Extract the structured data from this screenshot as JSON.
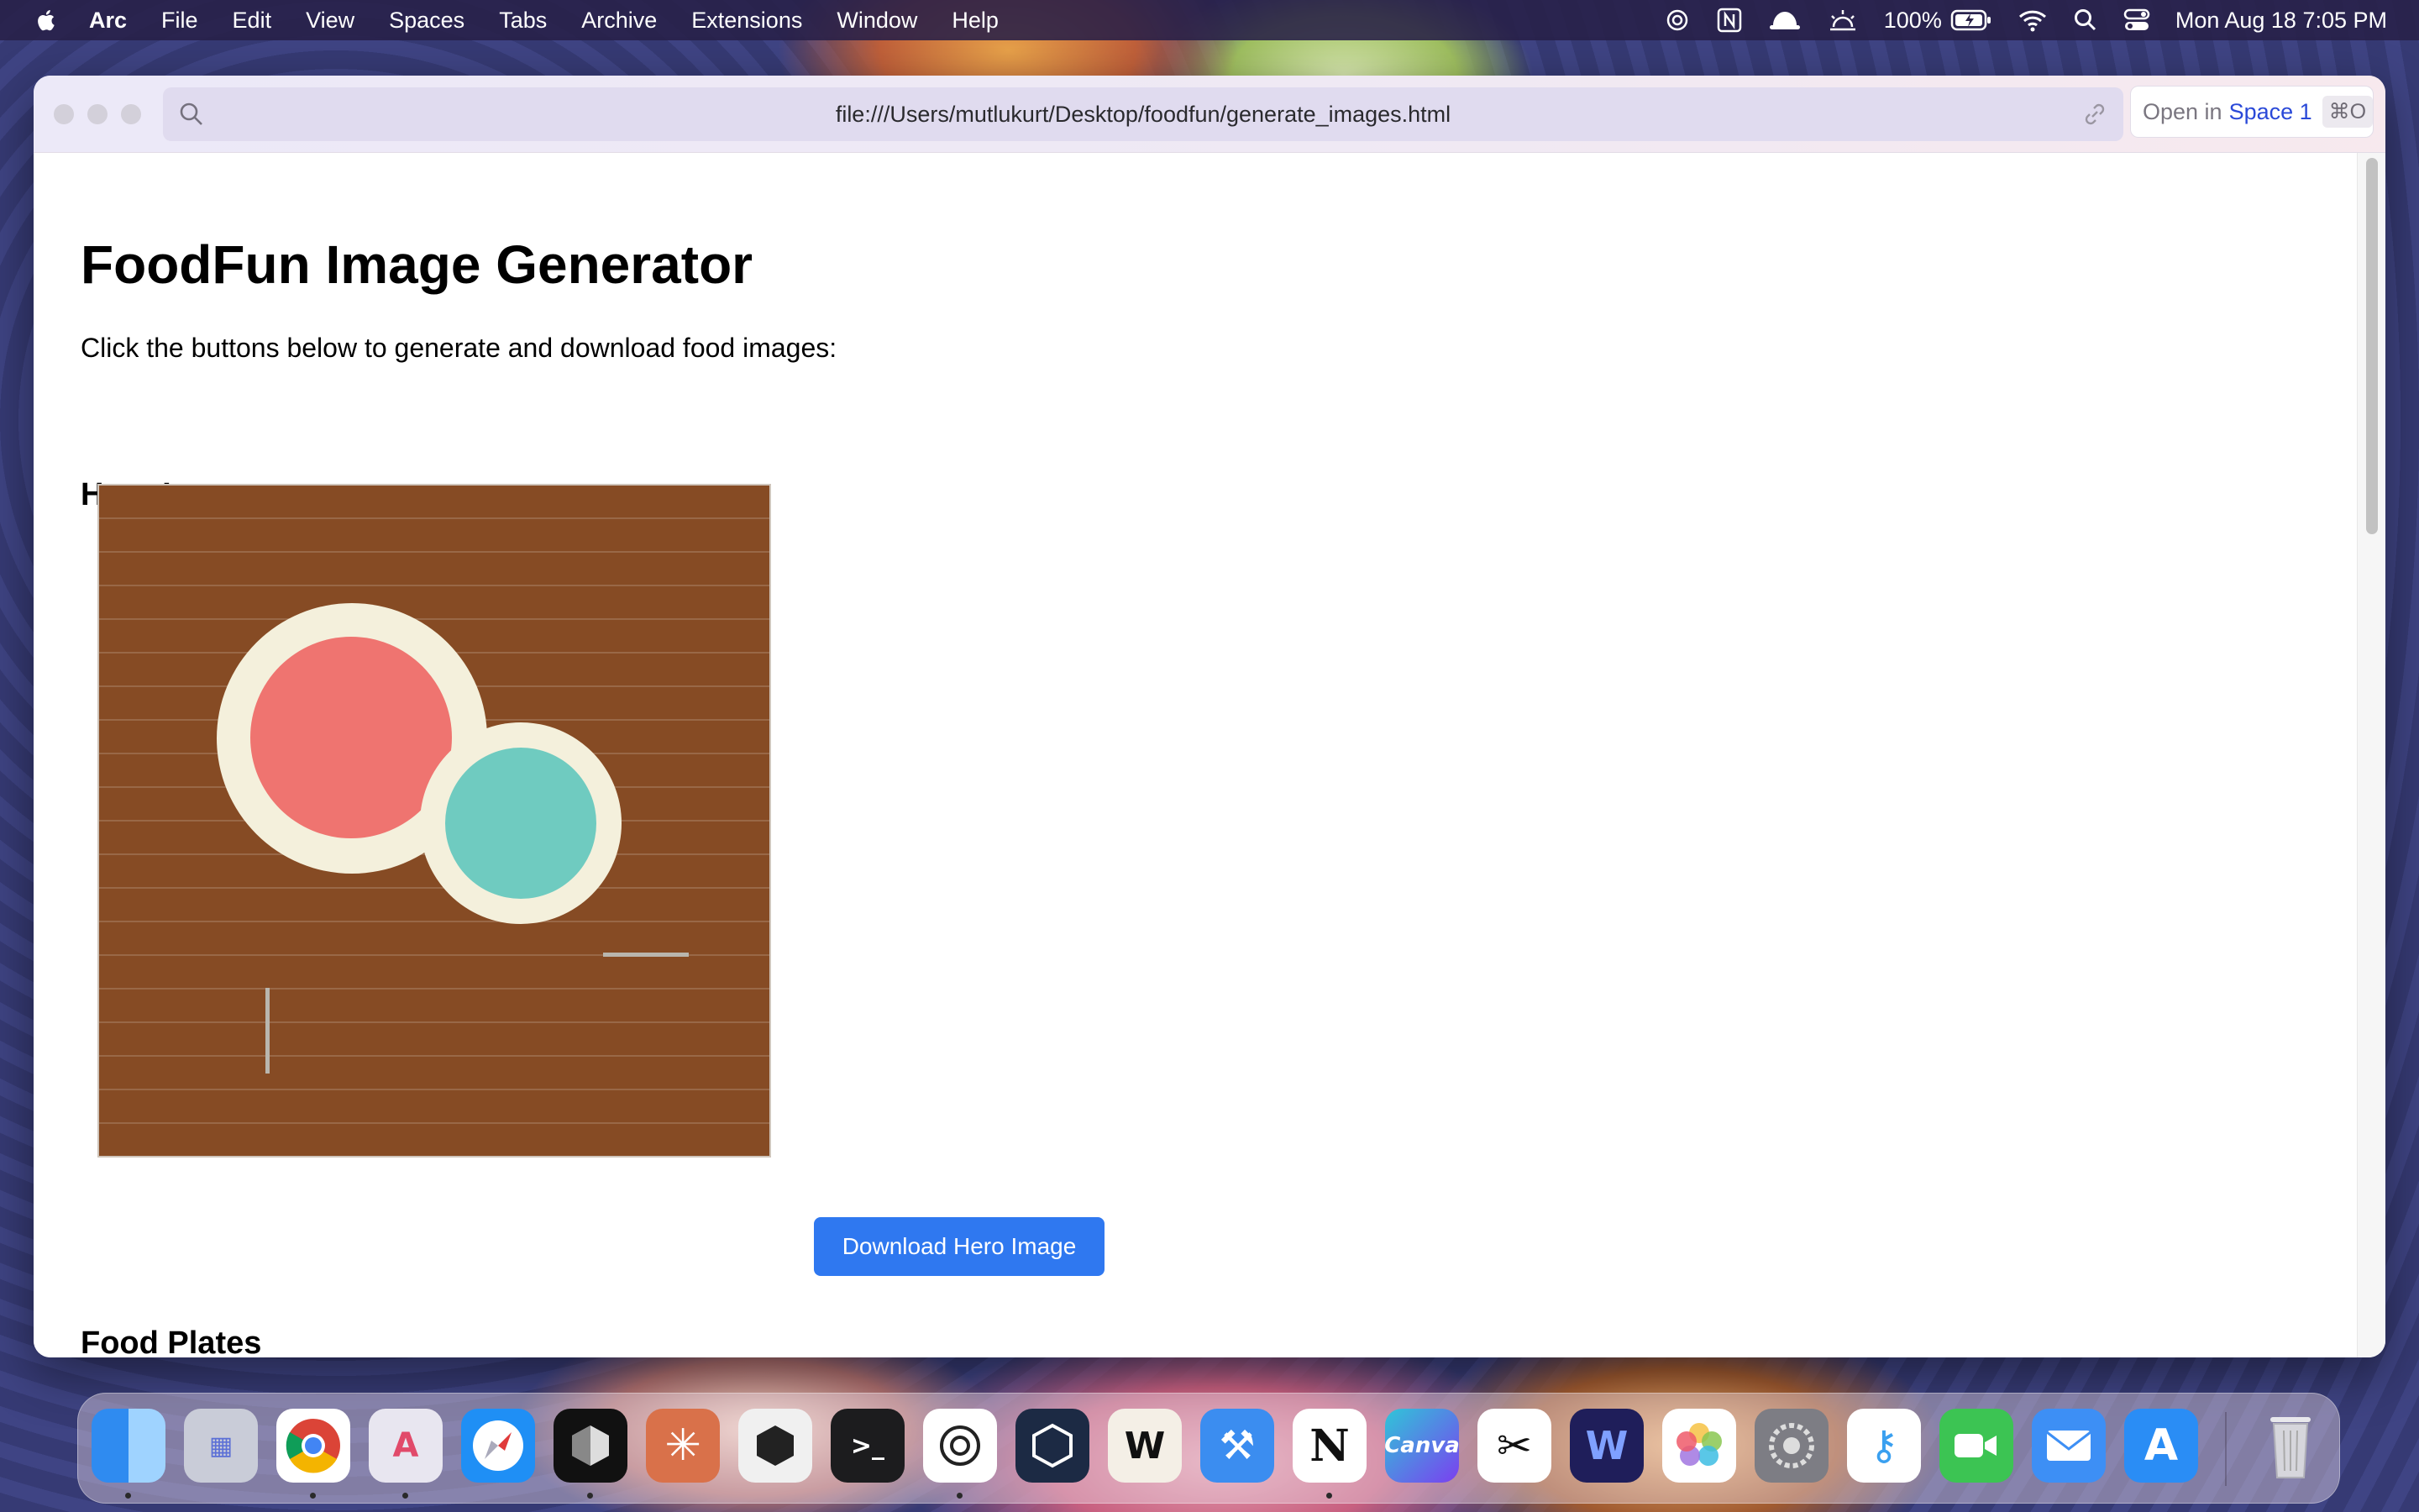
{
  "menubar": {
    "app_name": "Arc",
    "menus": [
      "File",
      "Edit",
      "View",
      "Spaces",
      "Tabs",
      "Archive",
      "Extensions",
      "Window",
      "Help"
    ],
    "battery": "100%",
    "datetime": "Mon Aug 18  7:05 PM"
  },
  "browser": {
    "url": "file:///Users/mutlukurt/Desktop/foodfun/generate_images.html",
    "open_in_prefix": "Open in",
    "open_in_space": "Space 1",
    "open_in_shortcut": "⌘O"
  },
  "page": {
    "title": "FoodFun Image Generator",
    "intro": "Click the buttons below to generate and download food images:",
    "hero_heading": "Hero Image",
    "download_hero_label": "Download Hero Image",
    "plates_heading": "Food Plates"
  },
  "colors": {
    "table_wood": "#864b24",
    "plate": "#f4f0dc",
    "food_red": "#ef7470",
    "food_teal": "#6fcbc0",
    "button_blue": "#2f78f0"
  },
  "dock": {
    "apps": [
      "Finder",
      "Launchpad",
      "Google Chrome",
      "Affinity",
      "Safari",
      "Cursor",
      "Claude",
      "Xcode Companion",
      "Terminal",
      "ChatGPT",
      "Retcon",
      "Warp",
      "Xcode",
      "Notion",
      "Canva",
      "CapCut",
      "Windsurf",
      "Photos",
      "System Settings",
      "Passwords",
      "FaceTime",
      "Mail",
      "App Store",
      "Trash"
    ]
  }
}
